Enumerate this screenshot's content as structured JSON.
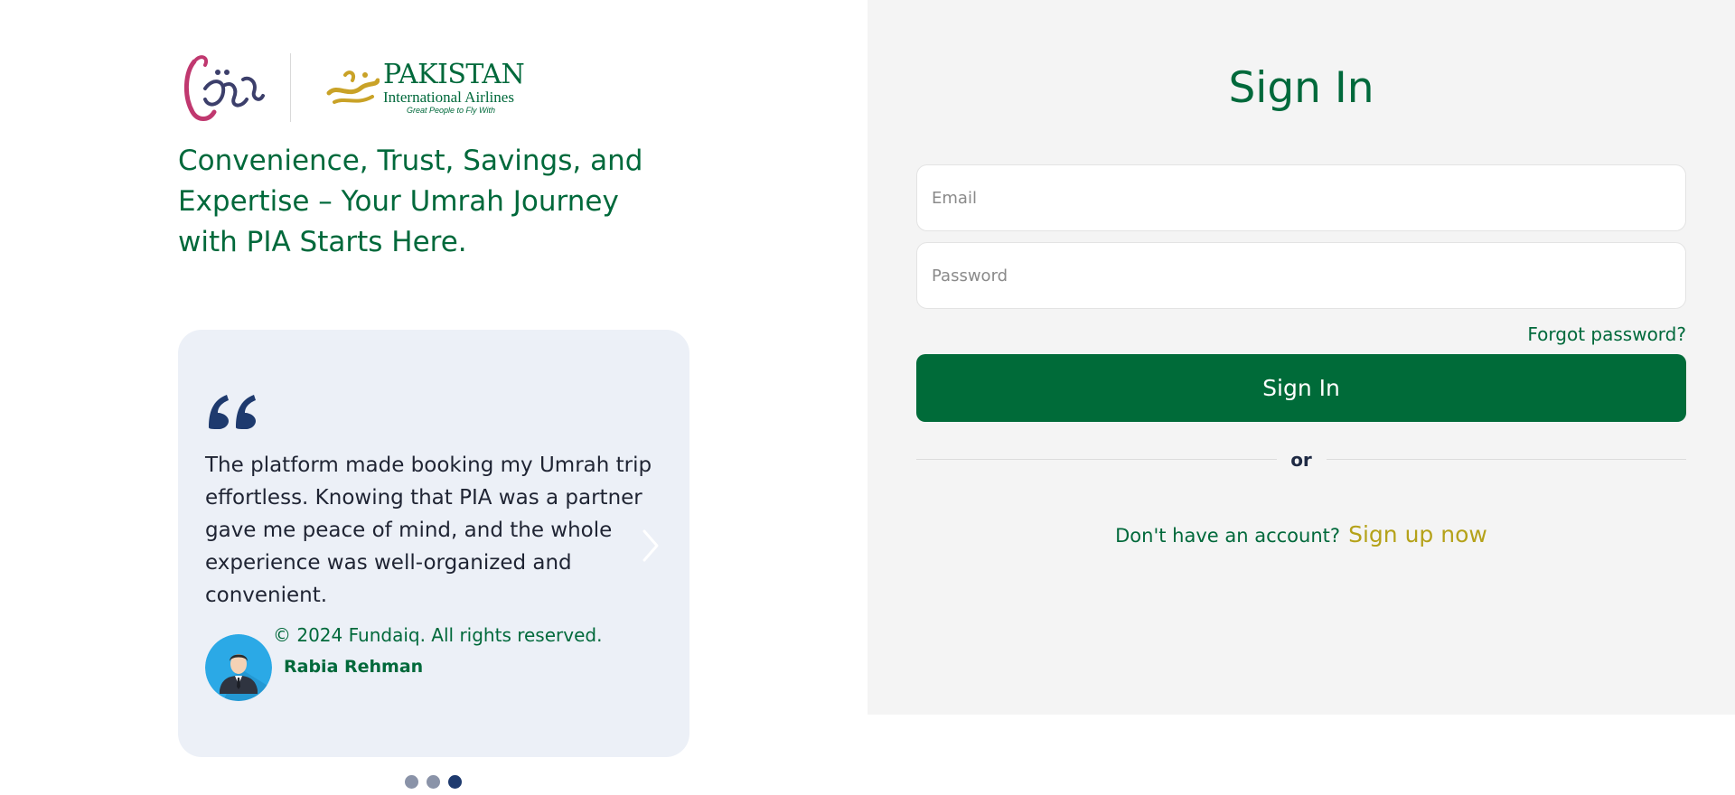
{
  "brand": {
    "fundaiq_logo_alt": "Fundaiq logo",
    "pia_name": "PAKISTAN",
    "pia_subtitle": "International Airlines",
    "pia_tagline": "Great People to Fly With"
  },
  "hero": {
    "headline": "Convenience, Trust, Savings, and Expertise – Your Umrah Journey with PIA Starts Here."
  },
  "testimonial": {
    "quote": "The platform made booking my Umrah trip effortless. Knowing that PIA was a partner gave me peace of mind, and the whole experience was well-organized and convenient.",
    "copyright": "© 2024 Fundaiq. All rights reserved.",
    "author": "Rabia Rehman",
    "slides_total": 3,
    "active_slide": 3
  },
  "signin": {
    "title": "Sign In",
    "email_placeholder": "Email",
    "password_placeholder": "Password",
    "forgot_label": "Forgot password?",
    "button_label": "Sign In",
    "divider_label": "or",
    "signup_prompt": "Don't have an account?",
    "signup_link": "Sign up now"
  },
  "colors": {
    "brand_green": "#00693b",
    "button_green": "#006b39",
    "gold": "#b5a21a",
    "navy": "#1e3a6e",
    "panel_bg": "#f4f4f4",
    "card_bg": "#ecf0f7"
  },
  "icons": {
    "quote": "quote-icon",
    "next": "chevron-right-icon",
    "avatar": "user-avatar-icon"
  }
}
